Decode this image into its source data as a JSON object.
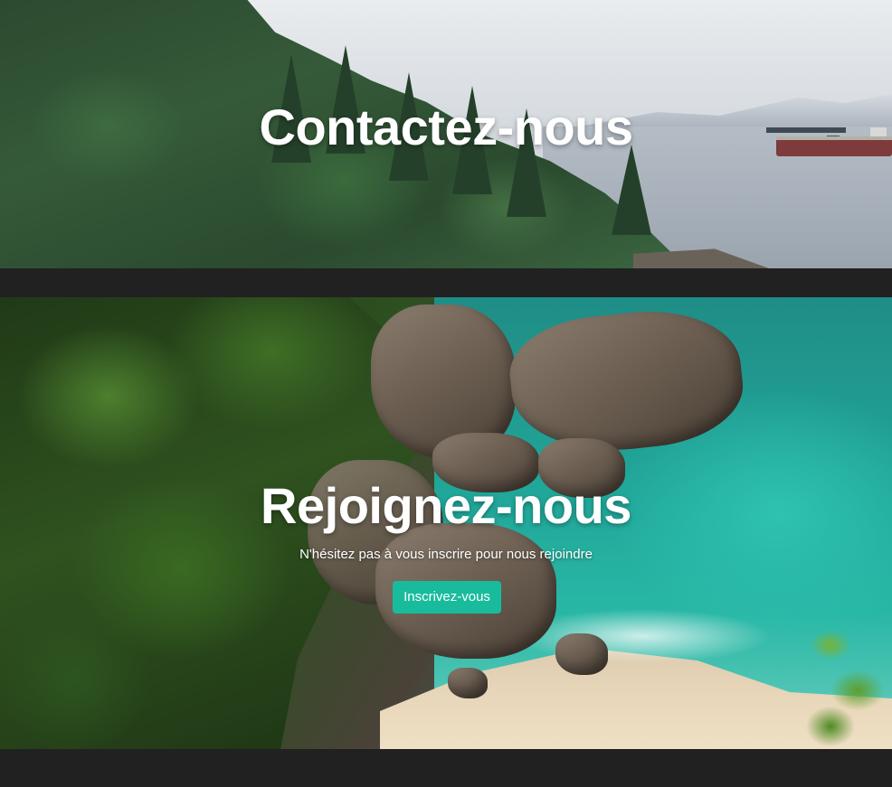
{
  "contact_section": {
    "title": "Contactez-nous"
  },
  "join_section": {
    "title": "Rejoignez-nous",
    "subtitle": "N'hésitez pas à vous inscrire pour nous rejoindre",
    "button_label": "Inscrivez-vous"
  },
  "colors": {
    "background": "#212121",
    "accent": "#18bc9c",
    "text": "#ffffff"
  }
}
